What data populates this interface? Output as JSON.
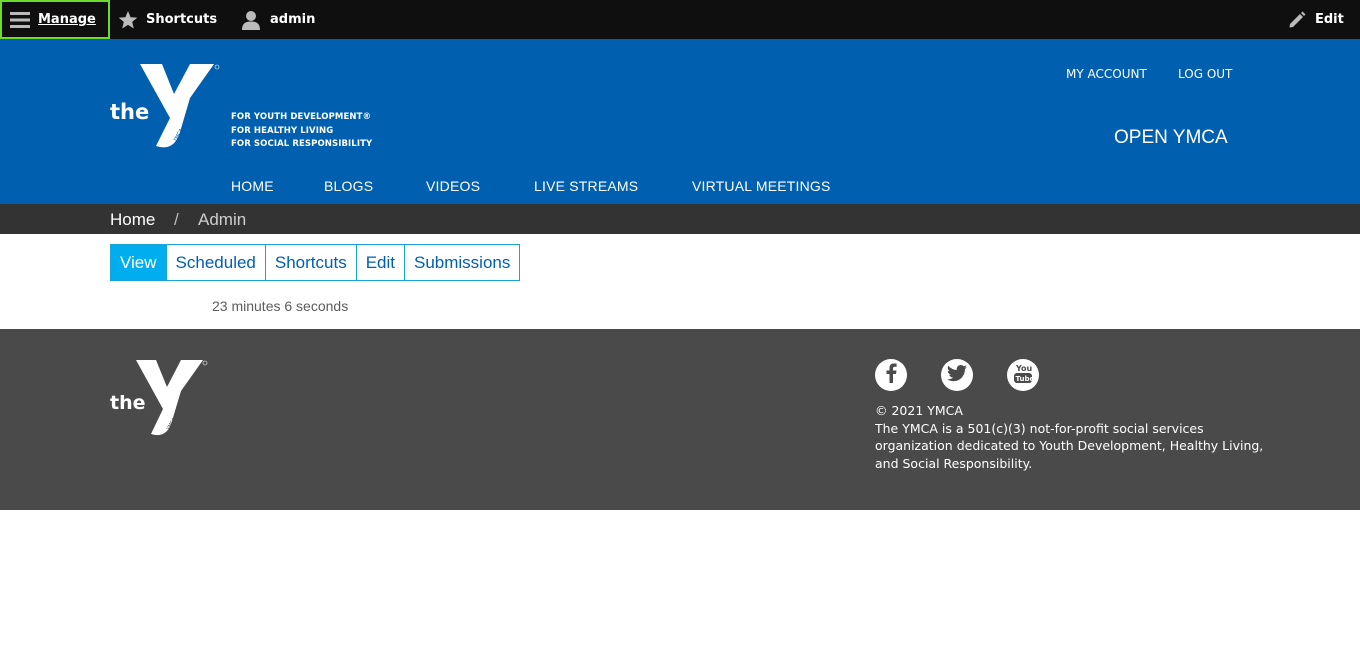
{
  "toolbar": {
    "manage_label": "Manage",
    "shortcuts_label": "Shortcuts",
    "user_label": "admin",
    "edit_label": "Edit",
    "icons": [
      "menu-icon",
      "star-icon",
      "user-icon",
      "pencil-icon"
    ]
  },
  "header": {
    "logo_text": "the",
    "logo_ymca": "YMCA",
    "tagline": [
      "FOR YOUTH DEVELOPMENT®",
      "FOR HEALTHY LIVING",
      "FOR SOCIAL RESPONSIBILITY"
    ],
    "account": {
      "my_account": "MY ACCOUNT",
      "log_out": "LOG OUT"
    },
    "site_name": "OPEN YMCA",
    "nav": [
      "HOME",
      "BLOGS",
      "VIDEOS",
      "LIVE STREAMS",
      "VIRTUAL MEETINGS"
    ],
    "brand_color": "#0060af"
  },
  "breadcrumb": {
    "home": "Home",
    "separator": "/",
    "current": "Admin"
  },
  "tabs": [
    {
      "label": "View",
      "active": true
    },
    {
      "label": "Scheduled",
      "active": false
    },
    {
      "label": "Shortcuts",
      "active": false
    },
    {
      "label": "Edit",
      "active": false
    },
    {
      "label": "Submissions",
      "active": false
    }
  ],
  "main": {
    "duration": "23 minutes 6 seconds"
  },
  "footer": {
    "logo_text": "the",
    "logo_ymca": "YMCA",
    "social": [
      "facebook-icon",
      "twitter-icon",
      "youtube-icon"
    ],
    "copyright_line1": "© 2021 YMCA",
    "copyright_line2": "The YMCA is a 501(c)(3) not-for-profit social services organization dedicated to Youth Development, Healthy Living, and Social Responsibility.",
    "background": "#4a4a4a"
  }
}
